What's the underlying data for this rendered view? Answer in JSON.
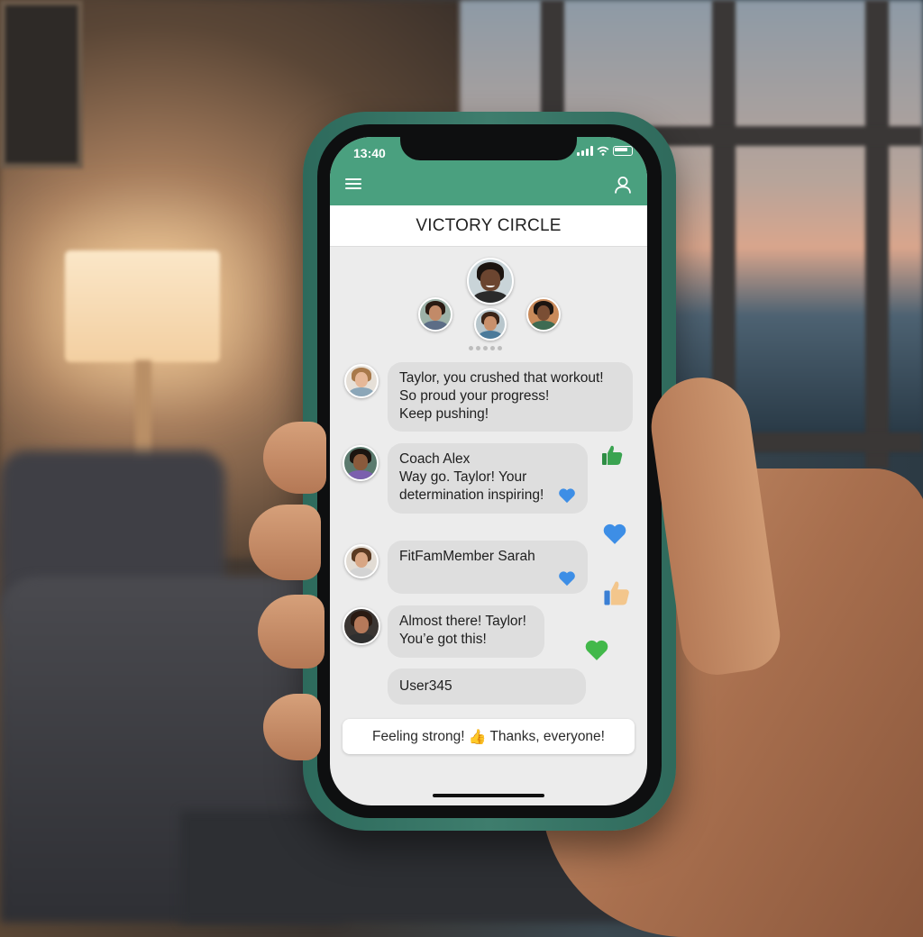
{
  "status_bar": {
    "time": "13:40"
  },
  "header": {
    "title": "VICTORY CIRCLE"
  },
  "icons": {
    "menu": "hamburger-menu-icon",
    "profile": "user-profile-icon",
    "heart_blue": "blue-heart-icon",
    "heart_green": "green-heart-icon",
    "thumbs_up": "thumbs-up-icon"
  },
  "colors": {
    "app_bar": "#4aa07f",
    "phone_case": "#3e7d6d",
    "bubble": "#dedede",
    "heart_blue": "#3d8ee6",
    "heart_green": "#42b84a",
    "thumb_green": "#3aa350"
  },
  "messages": [
    {
      "lines": [
        "Taylor, you crushed that workout!",
        "So proud your progress!",
        "Keep pushing!"
      ]
    },
    {
      "lines": [
        "Coach Alex",
        "Way go. Taylor! Your",
        "determination inspiring!"
      ]
    },
    {
      "lines": [
        "FitFamMember Sarah"
      ]
    },
    {
      "lines": [
        "Almost there! Taylor!",
        "You’e got this!"
      ]
    },
    {
      "lines": [
        "User345"
      ]
    }
  ],
  "composer": {
    "text_before": "Feeling strong!",
    "emoji": "👍",
    "text_after": "Thanks, everyone!"
  }
}
